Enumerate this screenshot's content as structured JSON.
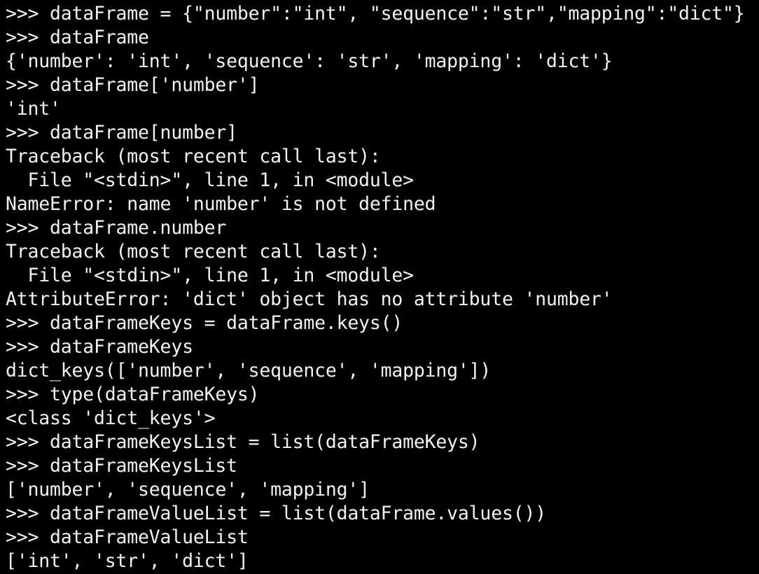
{
  "terminal": {
    "lines": [
      ">>> dataFrame = {\"number\":\"int\", \"sequence\":\"str\",\"mapping\":\"dict\"}",
      ">>> dataFrame",
      "{'number': 'int', 'sequence': 'str', 'mapping': 'dict'}",
      ">>> dataFrame['number']",
      "'int'",
      ">>> dataFrame[number]",
      "Traceback (most recent call last):",
      "  File \"<stdin>\", line 1, in <module>",
      "NameError: name 'number' is not defined",
      ">>> dataFrame.number",
      "Traceback (most recent call last):",
      "  File \"<stdin>\", line 1, in <module>",
      "AttributeError: 'dict' object has no attribute 'number'",
      ">>> dataFrameKeys = dataFrame.keys()",
      ">>> dataFrameKeys",
      "dict_keys(['number', 'sequence', 'mapping'])",
      ">>> type(dataFrameKeys)",
      "<class 'dict_keys'>",
      ">>> dataFrameKeysList = list(dataFrameKeys)",
      ">>> dataFrameKeysList",
      "['number', 'sequence', 'mapping']",
      ">>> dataFrameValueList = list(dataFrame.values())",
      ">>> dataFrameValueList",
      "['int', 'str', 'dict']"
    ],
    "colors": {
      "background": "#000000",
      "foreground": "#f2f2f2"
    }
  }
}
